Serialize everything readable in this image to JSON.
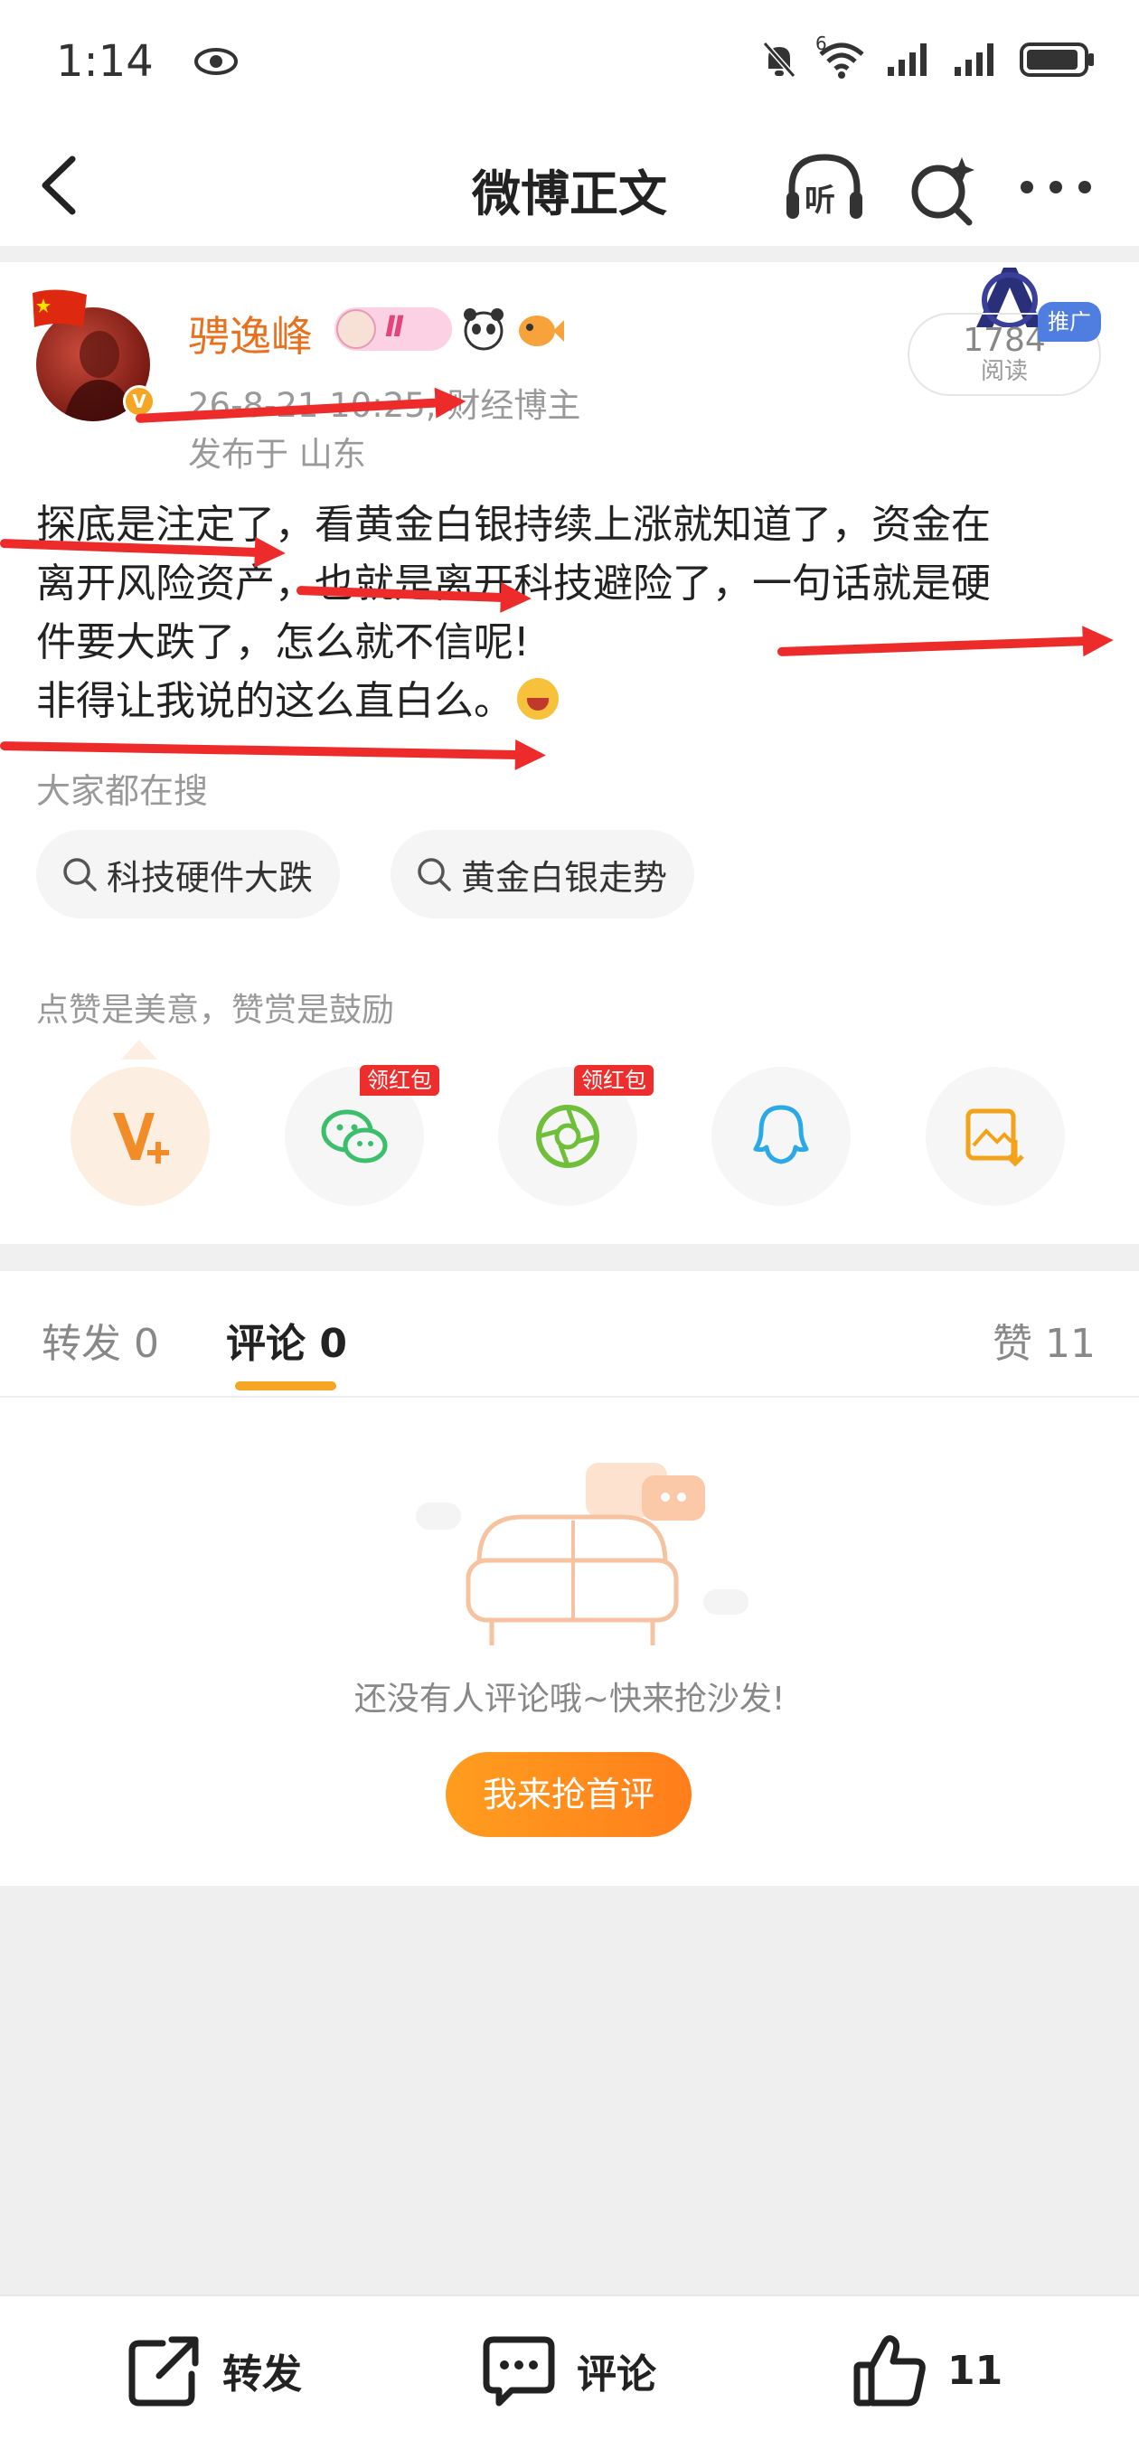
{
  "status_bar": {
    "time": "1:14",
    "network_label": "6"
  },
  "nav": {
    "title": "微博正文",
    "listen_label": "听"
  },
  "post": {
    "author": "骋逸峰",
    "medal_text": "Ⅱ",
    "date": "26-8-21 10:25",
    "author_tag": "财经博主",
    "location": "发布于 山东",
    "reads": "1784",
    "reads_label": "阅读",
    "promo_badge": "推广",
    "body_line1": "探底是注定了，看黄金白银持续上涨就知道了，资金在",
    "body_line2": "离开风险资产，也就是离开科技避险了，一句话就是硬",
    "body_line3": "件要大跌了，怎么就不信呢!",
    "body_line4": "非得让我说的这么直白么。"
  },
  "search": {
    "label": "大家都在搜",
    "chips": [
      "科技硬件大跌",
      "黄金白银走势"
    ]
  },
  "reward_hint": "点赞是美意，赞赏是鼓励",
  "share": {
    "red_tag": "领红包",
    "items": [
      "reward",
      "wechat",
      "moments",
      "qq",
      "save-image"
    ]
  },
  "tabs": {
    "repost": "转发 0",
    "comment": "评论 0",
    "like": "赞 11"
  },
  "empty_state": {
    "text": "还没有人评论哦~快来抢沙发!",
    "button": "我来抢首评"
  },
  "bottom_bar": {
    "repost": "转发",
    "comment": "评论",
    "like_count": "11"
  },
  "colors": {
    "accent": "#f5a623",
    "username": "#e8711f",
    "annotation_arrow": "#ee2b2b"
  }
}
